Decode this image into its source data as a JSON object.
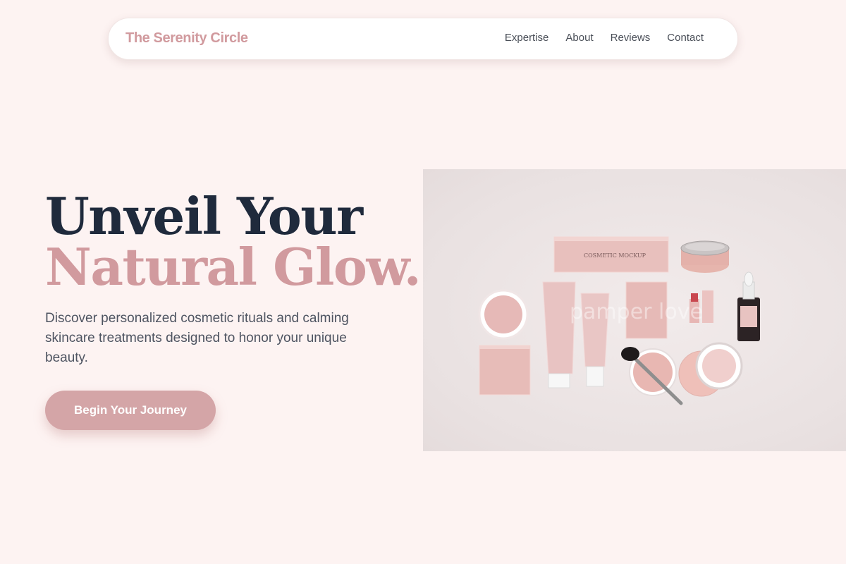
{
  "nav": {
    "brand": "The Serenity Circle",
    "links": [
      "Expertise",
      "About",
      "Reviews",
      "Contact"
    ]
  },
  "hero": {
    "title_line1": "Unveil Your",
    "title_line2": "Natural Glow.",
    "description": "Discover personalized cosmetic rituals and calming skincare treatments designed to honor your unique beauty.",
    "cta_label": "Begin Your Journey"
  },
  "image": {
    "product_label_a": "COSMETIC MOCKUP",
    "watermark": "pamper love"
  },
  "colors": {
    "background": "#fdf3f2",
    "brand": "#d19a9e",
    "heading_dark": "#1f2a3c",
    "button": "#d4a5a7",
    "body_text": "#4e5461"
  }
}
